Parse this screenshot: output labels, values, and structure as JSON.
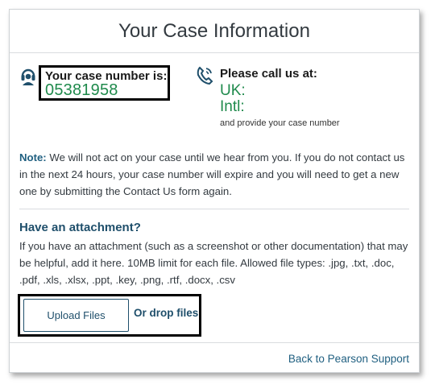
{
  "card": {
    "title": "Your Case Information"
  },
  "case": {
    "label": "Your case number is:",
    "number": "05381958"
  },
  "call": {
    "label": "Please call us at:",
    "uk": "UK:",
    "intl": "Intl:",
    "sub": "and provide your case number"
  },
  "note": {
    "prefix": "Note:",
    "text": " We will not act on your case until we hear from you. If you do not contact us in the next 24 hours, your case number will expire and you will need to get a new one by submitting the Contact Us form again."
  },
  "attachment": {
    "heading": "Have an attachment?",
    "text": "If you have an attachment (such as a screenshot or other documentation) that may be helpful, add it here. 10MB limit for each file. Allowed file types: .jpg, .txt, .doc, .pdf, .xls, .xlsx, .ppt, .key, .png, .rtf, .docx, .csv",
    "upload_label": "Upload Files",
    "drop_label": "Or drop files"
  },
  "footer": {
    "back_link": "Back to Pearson Support"
  },
  "icons": {
    "headset": "headset-icon",
    "phone": "phone-call-icon"
  },
  "colors": {
    "accent_green": "#1f8a4c",
    "link_blue": "#1f5f80",
    "heading_blue": "#1f4f6b"
  }
}
